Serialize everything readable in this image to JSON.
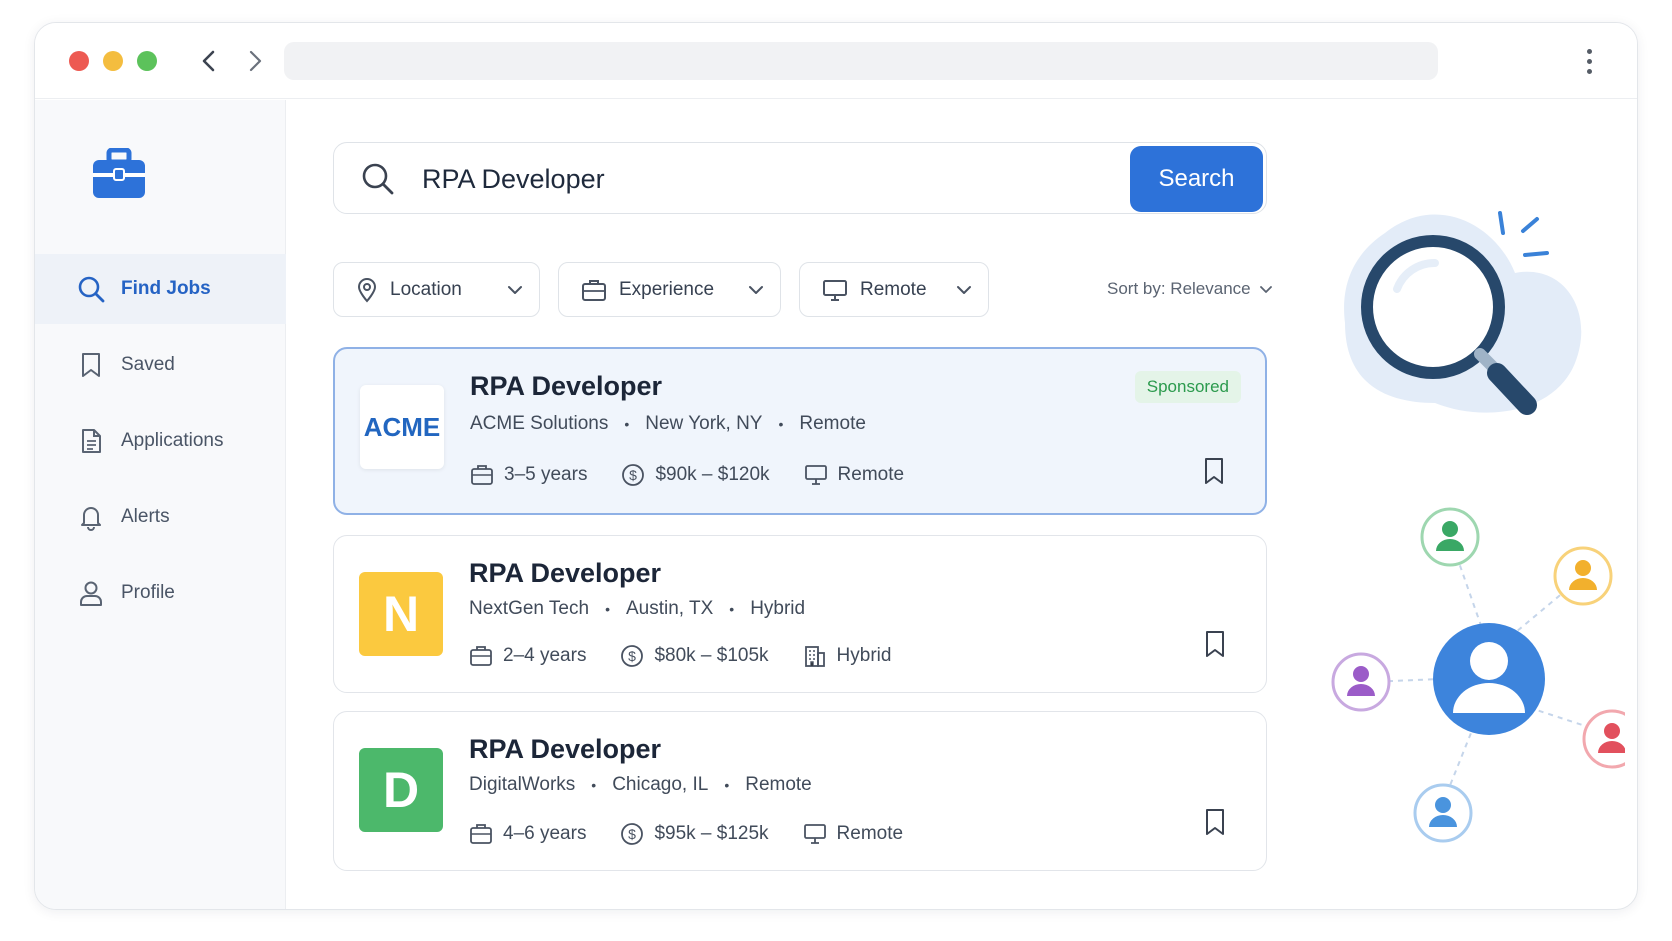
{
  "browser": {
    "back_icon": "chevron-left-icon",
    "forward_icon": "chevron-right-icon",
    "menu_icon": "kebab-menu-icon"
  },
  "sidebar": {
    "logo_icon": "briefcase-icon",
    "items": [
      {
        "label": "Find Jobs",
        "icon": "search-icon",
        "active": true
      },
      {
        "label": "Saved",
        "icon": "bookmark-icon",
        "active": false
      },
      {
        "label": "Applications",
        "icon": "document-icon",
        "active": false
      },
      {
        "label": "Alerts",
        "icon": "bell-icon",
        "active": false
      },
      {
        "label": "Profile",
        "icon": "user-icon",
        "active": false
      }
    ]
  },
  "search": {
    "value": "RPA Developer",
    "button_label": "Search"
  },
  "filters": [
    {
      "label": "Location",
      "icon": "location-pin-icon"
    },
    {
      "label": "Experience",
      "icon": "briefcase-icon"
    },
    {
      "label": "Remote",
      "icon": "monitor-icon"
    }
  ],
  "sort": {
    "label": "Sort by: Relevance"
  },
  "jobs": [
    {
      "title": "RPA Developer",
      "company": "ACME Solutions",
      "logo_text": "ACME",
      "location": "New York, NY",
      "work_mode": "Remote",
      "experience": "3–5 years",
      "salary": "$90k – $120k",
      "mode_detail": "Remote",
      "badge": "Sponsored"
    },
    {
      "title": "RPA Developer",
      "company": "NextGen Tech",
      "logo_text": "N",
      "location": "Austin, TX",
      "work_mode": "Hybrid",
      "experience": "2–4 years",
      "salary": "$80k – $105k",
      "mode_detail": "Hybrid"
    },
    {
      "title": "RPA Developer",
      "company": "DigitalWorks",
      "logo_text": "D",
      "location": "Chicago, IL",
      "work_mode": "Remote",
      "experience": "4–6 years",
      "salary": "$95k – $125k",
      "mode_detail": "Remote"
    }
  ],
  "colors": {
    "accent": "#2d72d9",
    "sponsored_bg": "#f0f5fc",
    "badge_green": "#2b9a4d",
    "logo_yellow": "#fbc93f",
    "logo_green": "#4cb86b"
  }
}
